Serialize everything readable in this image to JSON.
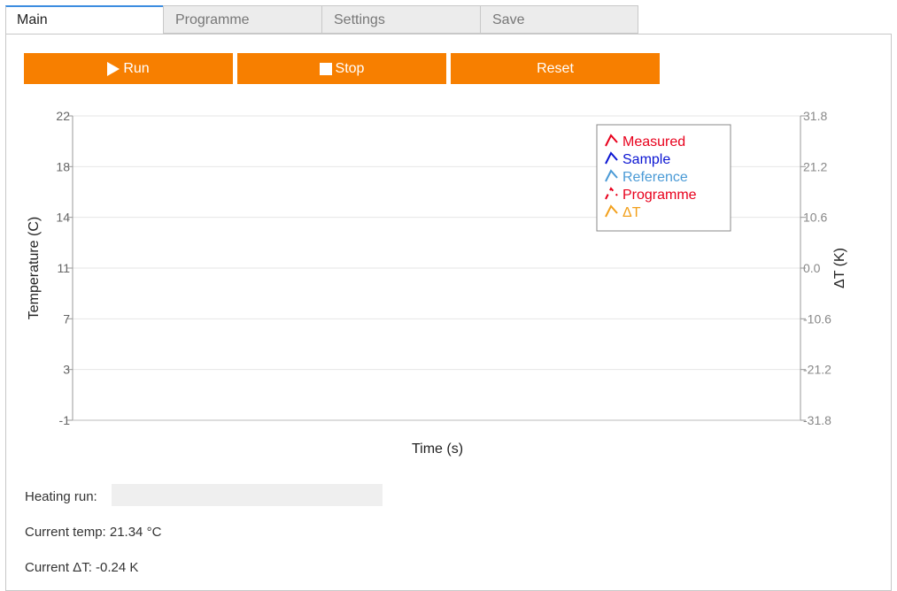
{
  "tabs": [
    {
      "label": "Main",
      "active": true
    },
    {
      "label": "Programme",
      "active": false
    },
    {
      "label": "Settings",
      "active": false
    },
    {
      "label": "Save",
      "active": false
    }
  ],
  "buttons": {
    "run": {
      "label": "Run",
      "icon": "play-icon"
    },
    "stop": {
      "label": "Stop",
      "icon": "stop-icon"
    },
    "reset": {
      "label": "Reset"
    }
  },
  "accent_color": "#f77f00",
  "chart_data": {
    "type": "line",
    "xlabel": "Time (s)",
    "ylabel": "Temperature (C)",
    "y2label": "ΔT (K)",
    "y_ticks": [
      "22",
      "18",
      "14",
      "11",
      "7",
      "3",
      "-1"
    ],
    "y2_ticks": [
      "31.8",
      "21.2",
      "10.6",
      "0.0",
      "-10.6",
      "-21.2",
      "-31.8"
    ],
    "ylim": [
      -1,
      22
    ],
    "y2lim": [
      -31.8,
      31.8
    ],
    "grid": true,
    "legend_position": "top-right",
    "series": [
      {
        "name": "Measured",
        "color": "#e8001c",
        "dashed": false,
        "values": []
      },
      {
        "name": "Sample",
        "color": "#0a14d2",
        "dashed": false,
        "values": []
      },
      {
        "name": "Reference",
        "color": "#4a9ad6",
        "dashed": false,
        "values": []
      },
      {
        "name": "Programme",
        "color": "#e8001c",
        "dashed": true,
        "values": []
      },
      {
        "name": "ΔT",
        "color": "#f2a01c",
        "dashed": false,
        "values": []
      }
    ]
  },
  "status": {
    "heating_label": "Heating run:",
    "heating_progress": 0,
    "current_temp": "Current temp: 21.34 °C",
    "current_dt": "Current ΔT: -0.24 K"
  }
}
